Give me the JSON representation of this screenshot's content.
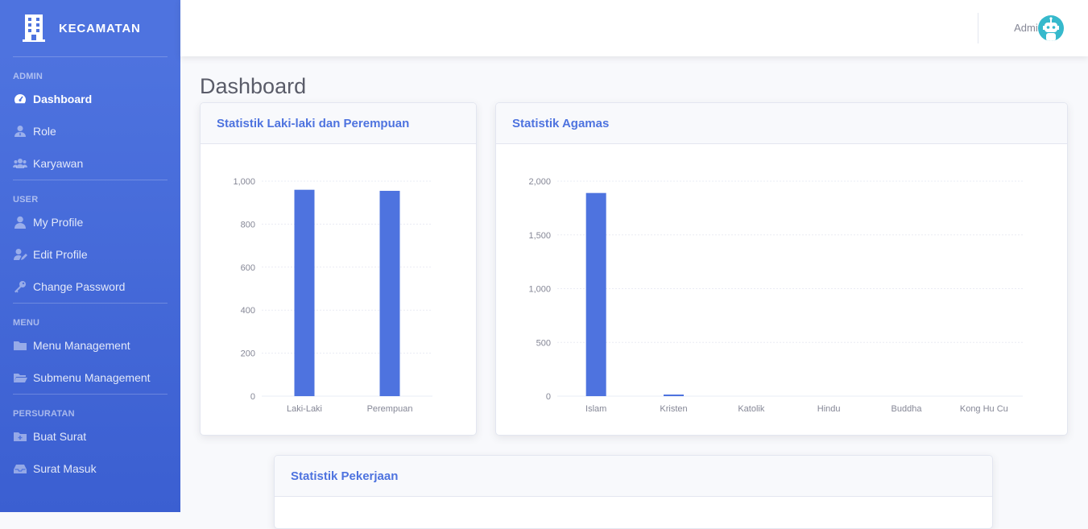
{
  "brand": {
    "name": "KECAMATAN",
    "icon": "building-icon"
  },
  "sidebar": {
    "sections": [
      {
        "heading": "ADMIN",
        "items": [
          {
            "label": "Dashboard",
            "icon": "tachometer-icon",
            "active": true
          },
          {
            "label": "Role",
            "icon": "user-tie-icon"
          },
          {
            "label": "Karyawan",
            "icon": "users-icon"
          }
        ]
      },
      {
        "heading": "USER",
        "items": [
          {
            "label": "My Profile",
            "icon": "user-icon"
          },
          {
            "label": "Edit Profile",
            "icon": "user-edit-icon"
          },
          {
            "label": "Change Password",
            "icon": "key-icon"
          }
        ]
      },
      {
        "heading": "MENU",
        "items": [
          {
            "label": "Menu Management",
            "icon": "folder-icon"
          },
          {
            "label": "Submenu Management",
            "icon": "folder-open-icon"
          }
        ]
      },
      {
        "heading": "PERSURATAN",
        "items": [
          {
            "label": "Buat Surat",
            "icon": "folder-plus-icon"
          },
          {
            "label": "Surat Masuk",
            "icon": "inbox-icon"
          }
        ]
      }
    ]
  },
  "topbar": {
    "user_name": "Admin",
    "avatar_icon": "robot-avatar-icon"
  },
  "page": {
    "title": "Dashboard"
  },
  "cards": {
    "gender": {
      "title": "Statistik Laki-laki dan Perempuan"
    },
    "religion": {
      "title": "Statistik Agamas"
    },
    "job": {
      "title": "Statistik Pekerjaan"
    }
  },
  "colors": {
    "accent": "#4e73df",
    "sidebar_dark": "#3b5fd1",
    "avatar": "#36b9cc"
  },
  "chart_data": [
    {
      "type": "bar",
      "title": "Statistik Laki-laki dan Perempuan",
      "categories": [
        "Laki-Laki",
        "Perempuan"
      ],
      "values": [
        960,
        955
      ],
      "ylim": [
        0,
        1000
      ],
      "yticks": [
        0,
        200,
        400,
        600,
        800,
        1000
      ],
      "ytick_labels": [
        "0",
        "200",
        "400",
        "600",
        "800",
        "1,000"
      ],
      "grid": true
    },
    {
      "type": "bar",
      "title": "Statistik Agamas",
      "categories": [
        "Islam",
        "Kristen",
        "Katolik",
        "Hindu",
        "Buddha",
        "Kong Hu Cu"
      ],
      "values": [
        1890,
        15,
        0,
        0,
        0,
        0
      ],
      "ylim": [
        0,
        2000
      ],
      "yticks": [
        0,
        500,
        1000,
        1500,
        2000
      ],
      "ytick_labels": [
        "0",
        "500",
        "1,000",
        "1,500",
        "2,000"
      ],
      "grid": true
    }
  ]
}
